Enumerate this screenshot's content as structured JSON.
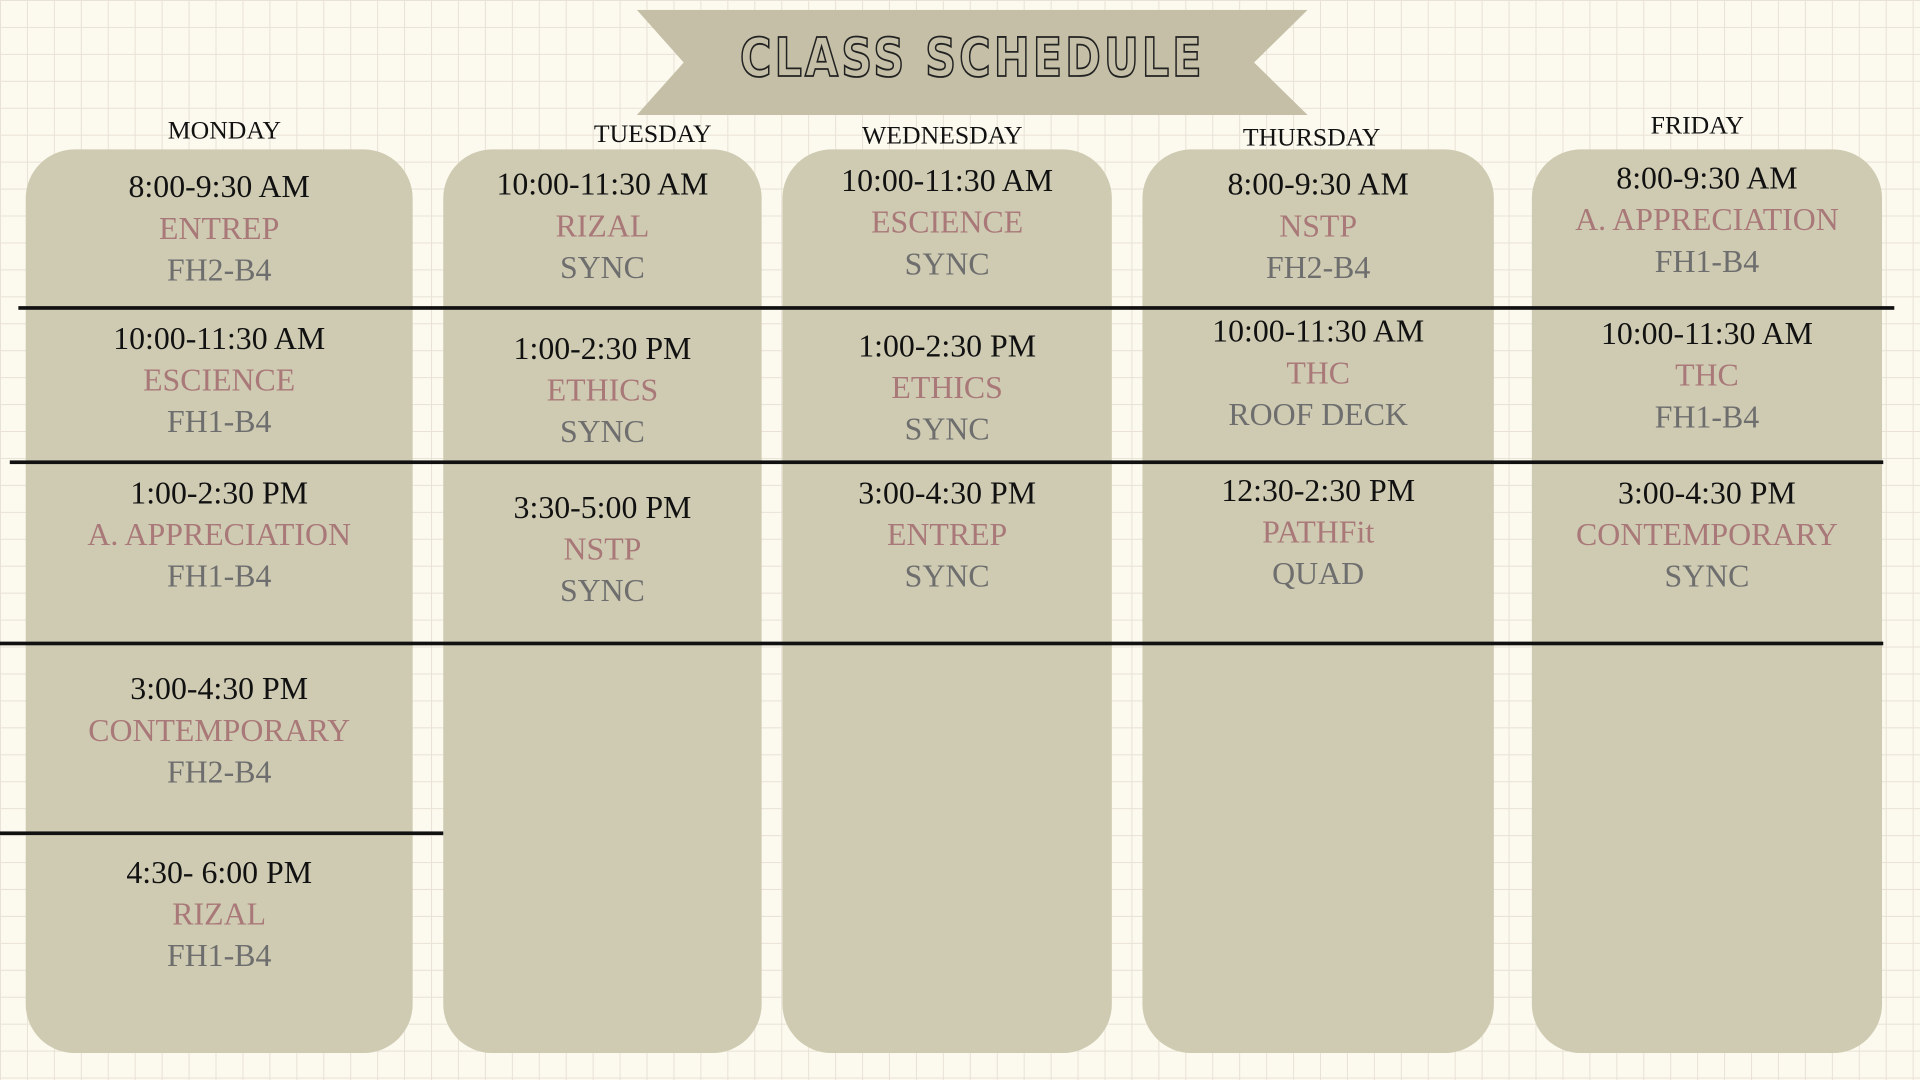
{
  "title": "CLASS SCHEDULE",
  "days": [
    {
      "name": "MONDAY",
      "slots": [
        {
          "time": "8:00-9:30 AM",
          "subject": "ENTREP",
          "room": "FH2-B4"
        },
        {
          "time": "10:00-11:30 AM",
          "subject": "ESCIENCE",
          "room": "FH1-B4"
        },
        {
          "time": "1:00-2:30 PM",
          "subject": "A. APPRECIATION",
          "room": "FH1-B4"
        },
        {
          "time": "3:00-4:30 PM",
          "subject": "CONTEMPORARY",
          "room": "FH2-B4"
        },
        {
          "time": "4:30- 6:00 PM",
          "subject": "RIZAL",
          "room": "FH1-B4"
        }
      ]
    },
    {
      "name": "TUESDAY",
      "slots": [
        {
          "time": "10:00-11:30 AM",
          "subject": "RIZAL",
          "room": "SYNC"
        },
        {
          "time": "1:00-2:30 PM",
          "subject": "ETHICS",
          "room": "SYNC"
        },
        {
          "time": "3:30-5:00 PM",
          "subject": "NSTP",
          "room": "SYNC"
        }
      ]
    },
    {
      "name": "WEDNESDAY",
      "slots": [
        {
          "time": "10:00-11:30 AM",
          "subject": "ESCIENCE",
          "room": "SYNC"
        },
        {
          "time": "1:00-2:30 PM",
          "subject": "ETHICS",
          "room": "SYNC"
        },
        {
          "time": "3:00-4:30 PM",
          "subject": "ENTREP",
          "room": "SYNC"
        }
      ]
    },
    {
      "name": "THURSDAY",
      "slots": [
        {
          "time": "8:00-9:30 AM",
          "subject": "NSTP",
          "room": "FH2-B4"
        },
        {
          "time": "10:00-11:30 AM",
          "subject": "THC",
          "room": "ROOF DECK"
        },
        {
          "time": "12:30-2:30 PM",
          "subject": "PATHFit",
          "room": "QUAD"
        }
      ]
    },
    {
      "name": "FRIDAY",
      "slots": [
        {
          "time": "8:00-9:30 AM",
          "subject": "A. APPRECIATION",
          "room": "FH1-B4"
        },
        {
          "time": "10:00-11:30 AM",
          "subject": "THC",
          "room": "FH1-B4"
        },
        {
          "time": "3:00-4:30 PM",
          "subject": "CONTEMPORARY",
          "room": "SYNC"
        }
      ]
    }
  ],
  "colors": {
    "background": "#fcf9ee",
    "column": "#cfcbb2",
    "banner": "#c4bfa6",
    "subject": "#a97878",
    "room": "#6e6e6e"
  }
}
